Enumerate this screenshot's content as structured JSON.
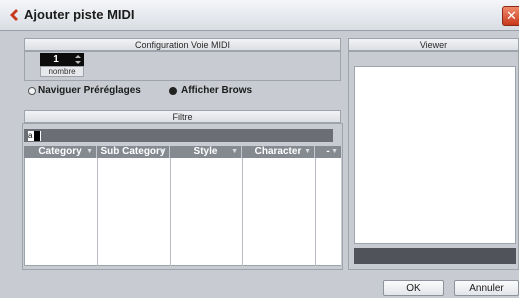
{
  "window": {
    "title": "Ajouter piste MIDI",
    "close_glyph": "✕"
  },
  "midi_config": {
    "header": "Configuration Voie MIDI",
    "count_value": "1",
    "count_label": "nombre"
  },
  "options": {
    "browse_presets_label": "Naviguer Préréglages",
    "show_browser_label": "Afficher Brows"
  },
  "filter": {
    "header": "Filtre",
    "search_value": "a"
  },
  "table": {
    "columns": [
      {
        "label": "Category"
      },
      {
        "label": "Sub Category"
      },
      {
        "label": "Style"
      },
      {
        "label": "Character"
      },
      {
        "label": "-"
      }
    ],
    "sort_glyph": "▼"
  },
  "viewer": {
    "header": "Viewer"
  },
  "buttons": {
    "ok": "OK",
    "cancel": "Annuler"
  },
  "colors": {
    "title_icon": "#c83a1e",
    "close_button": "#d2482a",
    "column_header": "#858a91",
    "viewer_bar": "#50545a"
  }
}
